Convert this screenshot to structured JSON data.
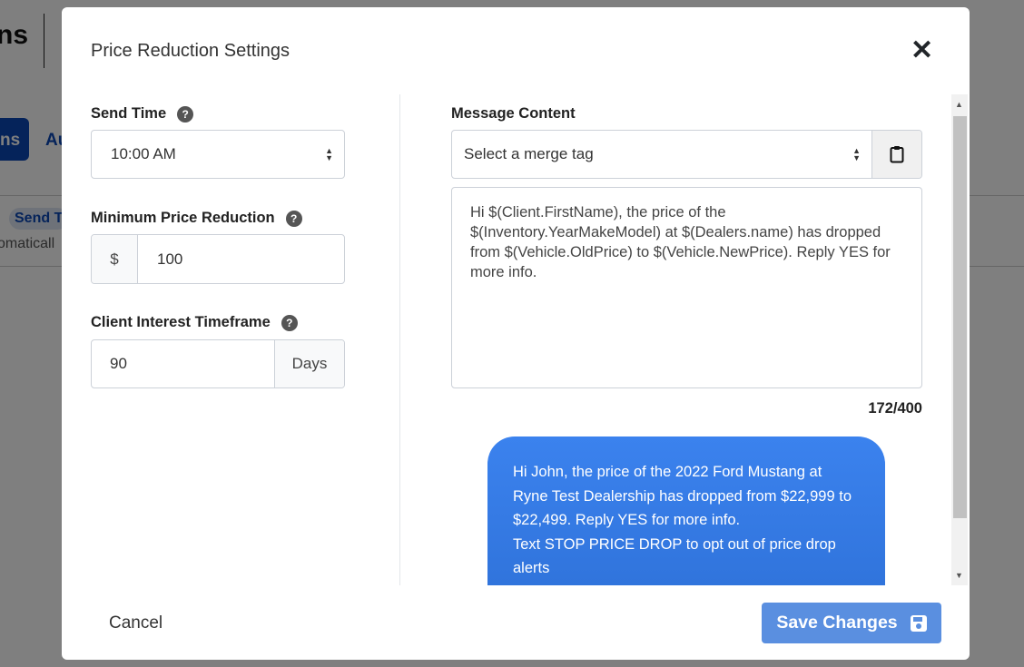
{
  "background": {
    "title_fragment": "ns",
    "active_button_fragment": "ns",
    "tab_fragment": "Au",
    "badge_fragment": "Send T",
    "text_fragment": "omaticall"
  },
  "modal": {
    "title": "Price Reduction Settings",
    "close_icon": "close-icon",
    "send_time": {
      "label": "Send Time",
      "value": "10:00 AM"
    },
    "min_price_reduction": {
      "label": "Minimum Price Reduction",
      "prefix": "$",
      "value": "100"
    },
    "client_interest_timeframe": {
      "label": "Client Interest Timeframe",
      "value": "90",
      "suffix": "Days"
    },
    "help_icon_glyph": "?",
    "message_content": {
      "label": "Message Content",
      "merge_tag_placeholder": "Select a merge tag",
      "text": "Hi $(Client.FirstName), the price of the $(Inventory.YearMakeModel) at $(Dealers.name) has dropped from $(Vehicle.OldPrice) to $(Vehicle.NewPrice). Reply YES for more info.",
      "char_count": "172/400",
      "preview_line1": "Hi John, the price of the 2022 Ford Mustang at Ryne Test Dealership has dropped from $22,999 to $22,499. Reply YES for more info.",
      "preview_line2": "Text STOP PRICE DROP to opt out of price drop alerts"
    },
    "cancel_label": "Cancel",
    "save_label": "Save Changes"
  },
  "colors": {
    "primary": "#5a8fe0",
    "bubble": "#3b82ee",
    "brand": "#0a47b5"
  }
}
